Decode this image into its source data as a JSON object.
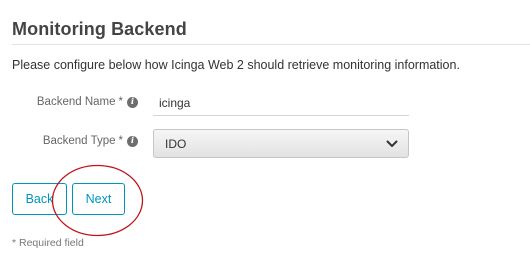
{
  "header": {
    "title": "Monitoring Backend",
    "intro": "Please configure below how Icinga Web 2 should retrieve monitoring information."
  },
  "form": {
    "backend_name": {
      "label": "Backend Name",
      "required_mark": "*",
      "info_icon": "info-circle-icon",
      "value": "icinga"
    },
    "backend_type": {
      "label": "Backend Type",
      "required_mark": "*",
      "info_icon": "info-circle-icon",
      "selected": "IDO",
      "dropdown_icon": "chevron-down-icon"
    }
  },
  "buttons": {
    "back_label": "Back",
    "next_label": "Next"
  },
  "footnote": "* Required field",
  "colors": {
    "accent": "#0095bf",
    "annotation_circle": "#c0141c",
    "title": "#444444"
  }
}
